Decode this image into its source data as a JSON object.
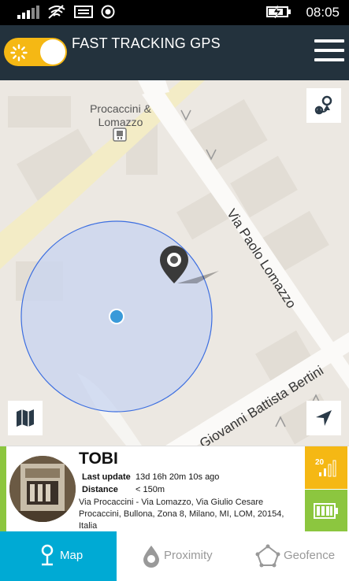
{
  "status_bar": {
    "time": "08:05"
  },
  "header": {
    "title": "FAST TRACKING GPS"
  },
  "map": {
    "poi_label": "Procaccini & Lomazzo",
    "streets": [
      "Via Paolo Lomazzo",
      "Giovanni Battista Bertini"
    ]
  },
  "device": {
    "name": "TOBI",
    "last_update_label": "Last update",
    "last_update_value": "13d 16h 20m 10s ago",
    "distance_label": "Distance",
    "distance_value": "< 150m",
    "address": "Via Procaccini - Via Lomazzo, Via Giulio Cesare Procaccini, Bullona, Zona 8, Milano, MI, LOM, 20154, Italia",
    "signal_value": "20"
  },
  "nav": {
    "tabs": [
      {
        "label": "Map",
        "active": true
      },
      {
        "label": "Proximity",
        "active": false
      },
      {
        "label": "Geofence",
        "active": false
      }
    ]
  },
  "colors": {
    "header_bg": "#23323d",
    "accent_yellow": "#f5b814",
    "accent_green": "#8cc63f",
    "nav_active": "#00aad4",
    "geofence_fill": "#c8d4f0",
    "geofence_stroke": "#3c6ee0"
  }
}
